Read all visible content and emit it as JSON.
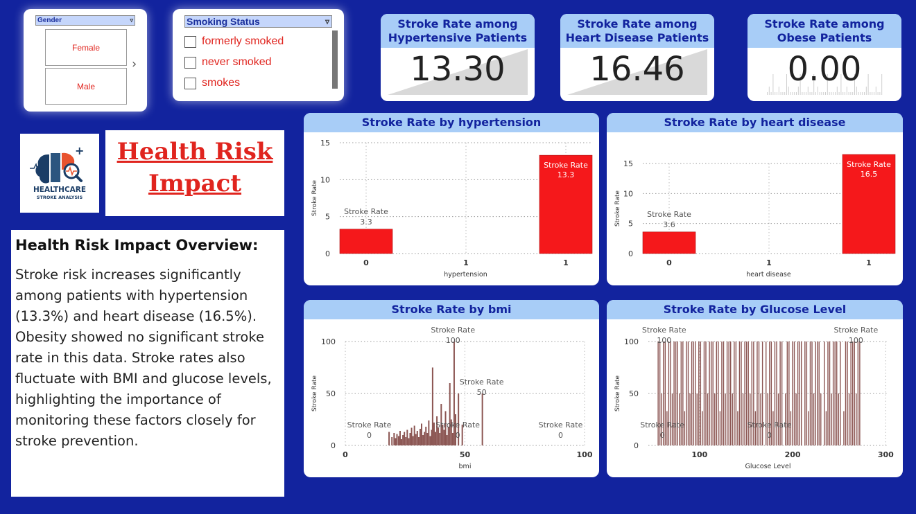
{
  "slicers": {
    "gender": {
      "header": "Gender",
      "options": [
        "Female",
        "Male"
      ]
    },
    "smoking": {
      "header": "Smoking Status",
      "options": [
        "formerly smoked",
        "never smoked",
        "smokes"
      ]
    }
  },
  "kpis": [
    {
      "title": "Stroke Rate among Hypertensive Patients",
      "value": "13.30"
    },
    {
      "title": "Stroke Rate among Heart Disease Patients",
      "value": "16.46"
    },
    {
      "title": "Stroke Rate among Obese Patients",
      "value": "0.00"
    }
  ],
  "logo": {
    "line1": "HEALTHCARE",
    "line2": "STROKE ANALYSIS"
  },
  "page_title": {
    "line1": "Health Risk",
    "line2": "Impact"
  },
  "overview": {
    "heading": "Health Risk Impact Overview:",
    "body": "Stroke risk increases significantly among patients with hypertension (13.3%) and heart disease (16.5%). Obesity showed no significant stroke rate in this data. Stroke rates also fluctuate with BMI and glucose levels, highlighting the importance of monitoring these factors closely for stroke prevention."
  },
  "colors": {
    "background": "#12239e",
    "header": "#a8cdf7",
    "title_text": "#12239e",
    "bar_red": "#f5181b",
    "bar_brown": "#8b5552",
    "accent_red": "#e0241e"
  },
  "chart_data": [
    {
      "type": "bar",
      "title": "Stroke Rate by hypertension",
      "xlabel": "hypertension",
      "ylabel": "Stroke Rate",
      "ticks_x": [
        "0",
        "1",
        "1"
      ],
      "ticks_y": [
        0,
        5,
        10,
        15
      ],
      "ylim": [
        0,
        15
      ],
      "categories": [
        "0",
        "1"
      ],
      "values": [
        3.3,
        13.3
      ],
      "data_label_name": "Stroke Rate",
      "labels": [
        "3.3",
        "13.3"
      ]
    },
    {
      "type": "bar",
      "title": "Stroke Rate by heart disease",
      "xlabel": "heart disease",
      "ylabel": "Stroke Rate",
      "ticks_x": [
        "0",
        "1",
        "1"
      ],
      "ticks_y": [
        0,
        5,
        10,
        15
      ],
      "ylim": [
        0,
        16.5
      ],
      "categories": [
        "0",
        "1"
      ],
      "values": [
        3.6,
        16.5
      ],
      "data_label_name": "Stroke Rate",
      "labels": [
        "3.6",
        "16.5"
      ]
    },
    {
      "type": "bar",
      "title": "Stroke Rate by bmi",
      "xlabel": "bmi",
      "ylabel": "Stroke Rate",
      "ticks_x": [
        0,
        50,
        100
      ],
      "ticks_y": [
        0,
        50,
        100
      ],
      "xlim": [
        0,
        100
      ],
      "ylim": [
        0,
        100
      ],
      "x": [
        18,
        19.2,
        20.1,
        20.7,
        21.3,
        22,
        22.6,
        23.2,
        23.8,
        24.4,
        25,
        25.6,
        26.2,
        26.8,
        27.4,
        28,
        28.6,
        29.2,
        29.8,
        30.4,
        31,
        31.6,
        32.2,
        32.8,
        33.4,
        34,
        34.6,
        35.2,
        35.8,
        36.2,
        36.8,
        37.4,
        38,
        38.6,
        39.2,
        39.8,
        40.4,
        41,
        41.6,
        42.2,
        42.8,
        43.4,
        44,
        44.6,
        45.2,
        45.8,
        47,
        48.6,
        57
      ],
      "values": [
        13,
        8,
        12,
        7,
        11,
        9,
        14,
        6,
        10,
        13,
        8,
        15,
        7,
        12,
        17,
        9,
        19,
        11,
        14,
        8,
        16,
        21,
        10,
        13,
        18,
        12,
        24,
        9,
        15,
        75,
        22,
        13,
        28,
        17,
        12,
        40,
        20,
        15,
        33,
        10,
        18,
        60,
        25,
        12,
        100,
        30,
        50,
        20,
        50
      ],
      "annotations": [
        {
          "text": "Stroke Rate",
          "value": "0",
          "x": 10
        },
        {
          "text": "Stroke Rate",
          "value": "100",
          "x": 45
        },
        {
          "text": "Stroke Rate",
          "value": "50",
          "x": 57
        },
        {
          "text": "Stroke Rate",
          "value": "0",
          "x": 47
        },
        {
          "text": "Stroke Rate",
          "value": "0",
          "x": 90
        }
      ]
    },
    {
      "type": "bar",
      "title": "Stroke Rate by Glucose Level",
      "xlabel": "Glucose Level",
      "ylabel": "Stroke Rate",
      "ticks_x": [
        100,
        200,
        300
      ],
      "ticks_y": [
        0,
        50,
        100
      ],
      "xlim": [
        45,
        302
      ],
      "ylim": [
        0,
        100
      ],
      "x_min": 55,
      "x_max": 272,
      "values_pattern": [
        100,
        100,
        50,
        100,
        100,
        33,
        100,
        100,
        50,
        100
      ],
      "annotations": [
        {
          "text": "Stroke Rate",
          "value": "100",
          "x": 62
        },
        {
          "text": "Stroke Rate",
          "value": "100",
          "x": 268
        },
        {
          "text": "Stroke Rate",
          "value": "0",
          "x": 60
        },
        {
          "text": "Stroke Rate",
          "value": "0",
          "x": 175
        }
      ]
    }
  ]
}
